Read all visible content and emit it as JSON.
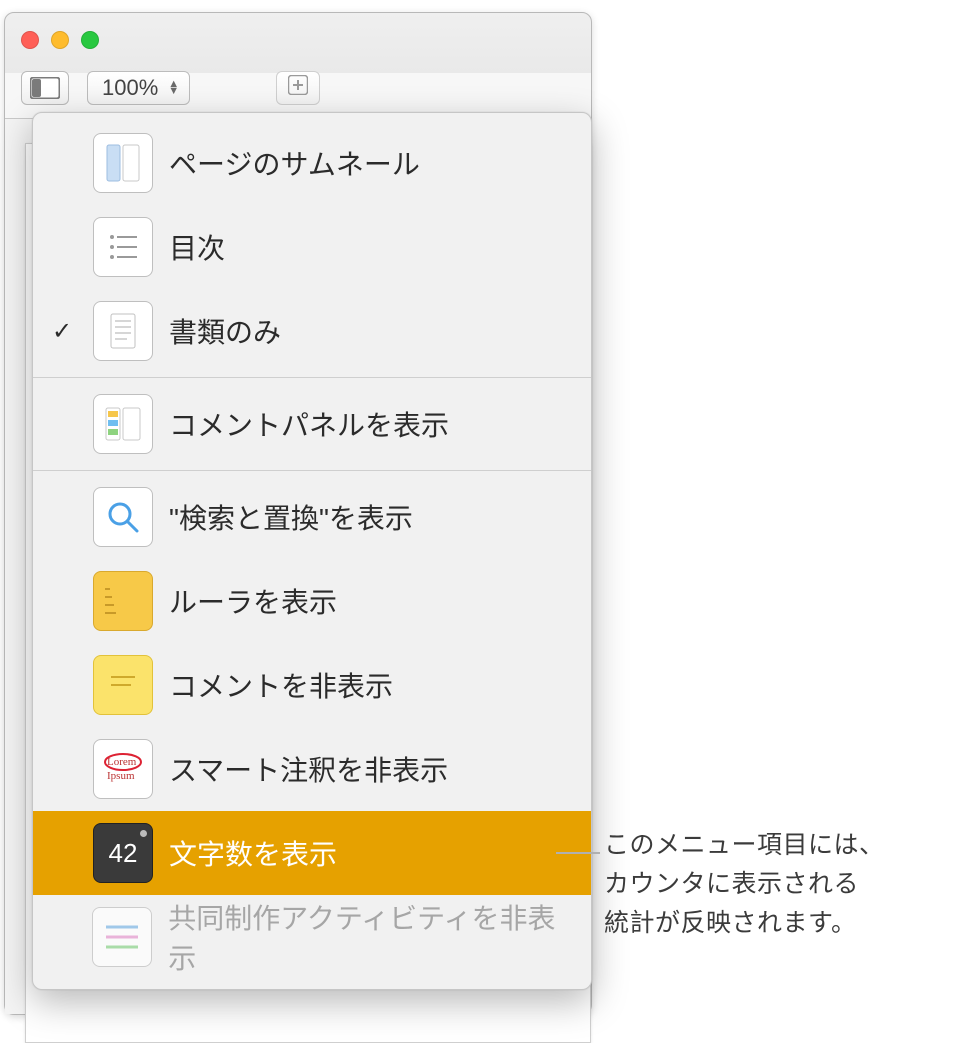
{
  "toolbar": {
    "zoom": "100%"
  },
  "menu": {
    "thumbnails": "ページのサムネール",
    "toc": "目次",
    "doc_only": "書類のみ",
    "comments_panel": "コメントパネルを表示",
    "find_replace": "\"検索と置換\"を表示",
    "ruler": "ルーラを表示",
    "hc": "コメントを非表示",
    "hide_comments": "コメントを非表示",
    "smart_annotations": "スマート注釈を非表示",
    "word_count": "文字数を表示",
    "word_count_number": "42",
    "collab_activity": "共同制作アクティビティを非表示"
  },
  "callout": {
    "line1": "このメニュー項目には、",
    "line2": "カウンタに表示される",
    "line3": "統計が反映されます。"
  }
}
